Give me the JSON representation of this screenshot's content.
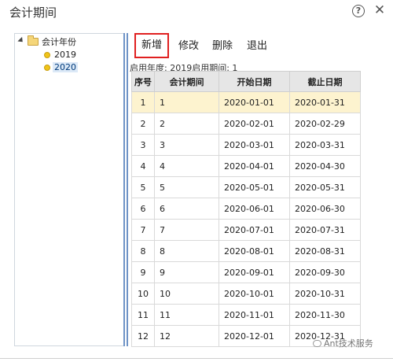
{
  "window": {
    "title": "会计期间"
  },
  "tree": {
    "root_label": "会计年份",
    "years": [
      {
        "label": "2019",
        "selected": false
      },
      {
        "label": "2020",
        "selected": true
      }
    ]
  },
  "toolbar": {
    "add_label": "新增",
    "edit_label": "修改",
    "delete_label": "删除",
    "exit_label": "退出"
  },
  "info": {
    "text": "启用年度:  2019启用期间:  1"
  },
  "table": {
    "headers": [
      "序号",
      "会计期间",
      "开始日期",
      "截止日期"
    ],
    "rows": [
      {
        "seq": "1",
        "period": "1",
        "start": "2020-01-01",
        "end": "2020-01-31"
      },
      {
        "seq": "2",
        "period": "2",
        "start": "2020-02-01",
        "end": "2020-02-29"
      },
      {
        "seq": "3",
        "period": "3",
        "start": "2020-03-01",
        "end": "2020-03-31"
      },
      {
        "seq": "4",
        "period": "4",
        "start": "2020-04-01",
        "end": "2020-04-30"
      },
      {
        "seq": "5",
        "period": "5",
        "start": "2020-05-01",
        "end": "2020-05-31"
      },
      {
        "seq": "6",
        "period": "6",
        "start": "2020-06-01",
        "end": "2020-06-30"
      },
      {
        "seq": "7",
        "period": "7",
        "start": "2020-07-01",
        "end": "2020-07-31"
      },
      {
        "seq": "8",
        "period": "8",
        "start": "2020-08-01",
        "end": "2020-08-31"
      },
      {
        "seq": "9",
        "period": "9",
        "start": "2020-09-01",
        "end": "2020-09-30"
      },
      {
        "seq": "10",
        "period": "10",
        "start": "2020-10-01",
        "end": "2020-10-31"
      },
      {
        "seq": "11",
        "period": "11",
        "start": "2020-11-01",
        "end": "2020-11-30"
      },
      {
        "seq": "12",
        "period": "12",
        "start": "2020-12-01",
        "end": "2020-12-31"
      }
    ]
  },
  "watermark": {
    "text": "Ant技术服务"
  },
  "colors": {
    "selected_row": "#fdf3cf",
    "highlight_border": "#e02020",
    "splitter": "#6f93c6"
  },
  "icons": {
    "help": "help-icon",
    "close": "close-icon",
    "folder": "folder-icon",
    "year": "year-dot-icon"
  }
}
